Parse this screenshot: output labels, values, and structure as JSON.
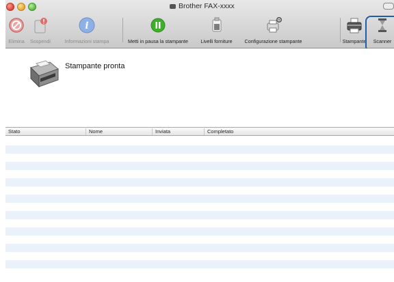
{
  "window": {
    "title": "Brother FAX-xxxx"
  },
  "toolbar": {
    "items": [
      {
        "id": "delete",
        "label": "Elimina",
        "icon": "delete-icon",
        "enabled": false
      },
      {
        "id": "hold",
        "label": "Sospendi",
        "icon": "hold-icon",
        "enabled": false
      },
      {
        "id": "job-info",
        "label": "Informazioni stampa",
        "icon": "info-icon",
        "enabled": false
      },
      {
        "id": "pause",
        "label": "Metti in pausa la stampante",
        "icon": "pause-icon",
        "enabled": true
      },
      {
        "id": "supply",
        "label": "Livelli forniture",
        "icon": "supply-levels-icon",
        "enabled": true
      },
      {
        "id": "config",
        "label": "Configurazione stampante",
        "icon": "printer-settings-icon",
        "enabled": true
      },
      {
        "id": "print",
        "label": "Stampante",
        "icon": "printer-icon",
        "enabled": true
      },
      {
        "id": "scanner",
        "label": "Scanner",
        "icon": "scanner-icon",
        "enabled": true
      }
    ]
  },
  "status": {
    "text": "Stampante pronta"
  },
  "table": {
    "columns": [
      "Stato",
      "Nome",
      "Inviata",
      "Completato"
    ],
    "rows": []
  },
  "colors": {
    "highlight": "#1f5fa8",
    "row_stripe": "#ebf1fb",
    "pause_green": "#3fae2a",
    "info_blue": "#4a7cc9"
  }
}
